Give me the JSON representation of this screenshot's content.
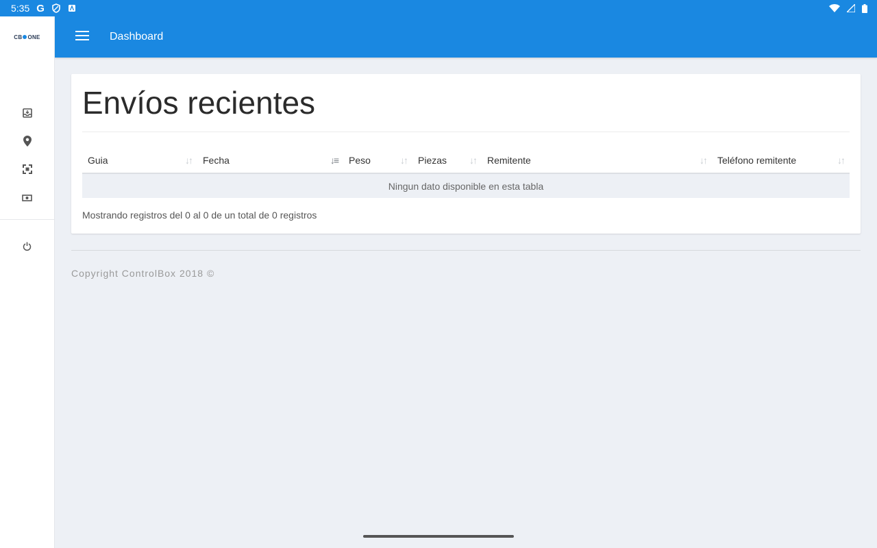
{
  "status_bar": {
    "time": "5:35",
    "g": "G"
  },
  "brand": {
    "left": "CB",
    "right": "ONE"
  },
  "header": {
    "title": "Dashboard"
  },
  "card": {
    "title": "Envíos recientes",
    "columns": [
      "Guia",
      "Fecha",
      "Peso",
      "Piezas",
      "Remitente",
      "Teléfono remitente"
    ],
    "empty_message": "Ningun dato disponible en esta tabla",
    "info": "Mostrando registros del 0 al 0 de un total de 0 registros"
  },
  "footer": {
    "copyright": "Copyright ControlBox 2018 ©"
  },
  "icons": {
    "menu": "menu-icon",
    "nav": [
      "inbox-icon",
      "location-pin-icon",
      "fullscreen-icon",
      "money-icon",
      "power-icon"
    ]
  },
  "colors": {
    "primary": "#1a88e1",
    "background": "#edf0f5"
  }
}
